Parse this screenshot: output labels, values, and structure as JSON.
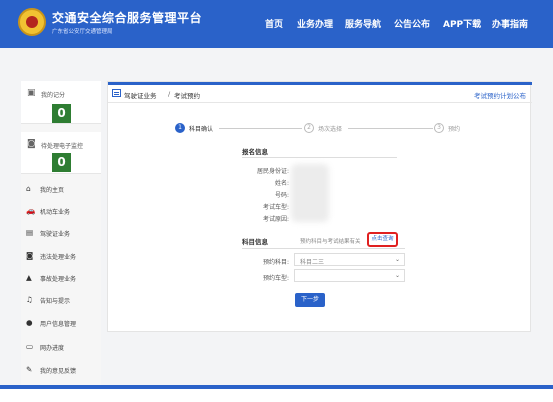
{
  "header": {
    "title": "交通安全综合服务管理平台",
    "subtitle": "广东省公安厅交通管理局",
    "nav": [
      "首页",
      "业务办理",
      "服务导航",
      "公告公布",
      "APP下载",
      "办事指南"
    ]
  },
  "sidebar": {
    "cards": [
      {
        "label": "我的记分",
        "count": "0",
        "icon": "license-card-icon"
      },
      {
        "label": "待处理电子监控",
        "count": "0",
        "icon": "camera-icon"
      }
    ],
    "menu": [
      {
        "label": "我的主页",
        "icon": "home-icon",
        "glyph": "⌂"
      },
      {
        "label": "机动车业务",
        "icon": "car-icon",
        "glyph": "🚗"
      },
      {
        "label": "驾驶证业务",
        "icon": "license-icon",
        "glyph": "▤"
      },
      {
        "label": "违法处理业务",
        "icon": "camera-icon",
        "glyph": "◙"
      },
      {
        "label": "事故处理业务",
        "icon": "warning-icon",
        "glyph": "▲"
      },
      {
        "label": "告知与提示",
        "icon": "bell-icon",
        "glyph": "♫"
      },
      {
        "label": "用户信息管理",
        "icon": "user-icon",
        "glyph": "●"
      },
      {
        "label": "网办进度",
        "icon": "progress-icon",
        "glyph": "▭"
      },
      {
        "label": "我的意见反馈",
        "icon": "feedback-icon",
        "glyph": "✎"
      }
    ]
  },
  "breadcrumb": {
    "main": "驾驶证业务",
    "sep": "/",
    "sub": "考试预约",
    "link": "考试预约计划公布"
  },
  "steps": [
    {
      "num": "1",
      "label": "科目确认",
      "active": true
    },
    {
      "num": "2",
      "label": "场次选择",
      "active": false
    },
    {
      "num": "3",
      "label": "预约",
      "active": false
    }
  ],
  "service_info": {
    "title": "报名信息",
    "fields": [
      "居民身份证:",
      "姓名:",
      "号码:",
      "考试车型:",
      "考试原因:"
    ]
  },
  "subject_info": {
    "title": "科目信息",
    "notice": "预约科目与考试结果有关",
    "query_label": "点击查询",
    "subject_label": "预约科目:",
    "subject_value": "科目二三",
    "vehicle_label": "预约车型:",
    "vehicle_value": ""
  },
  "next_label": "下一步",
  "colors": {
    "primary": "#2a62c9",
    "count_green": "#2e7d32",
    "highlight_red": "#e02020"
  }
}
